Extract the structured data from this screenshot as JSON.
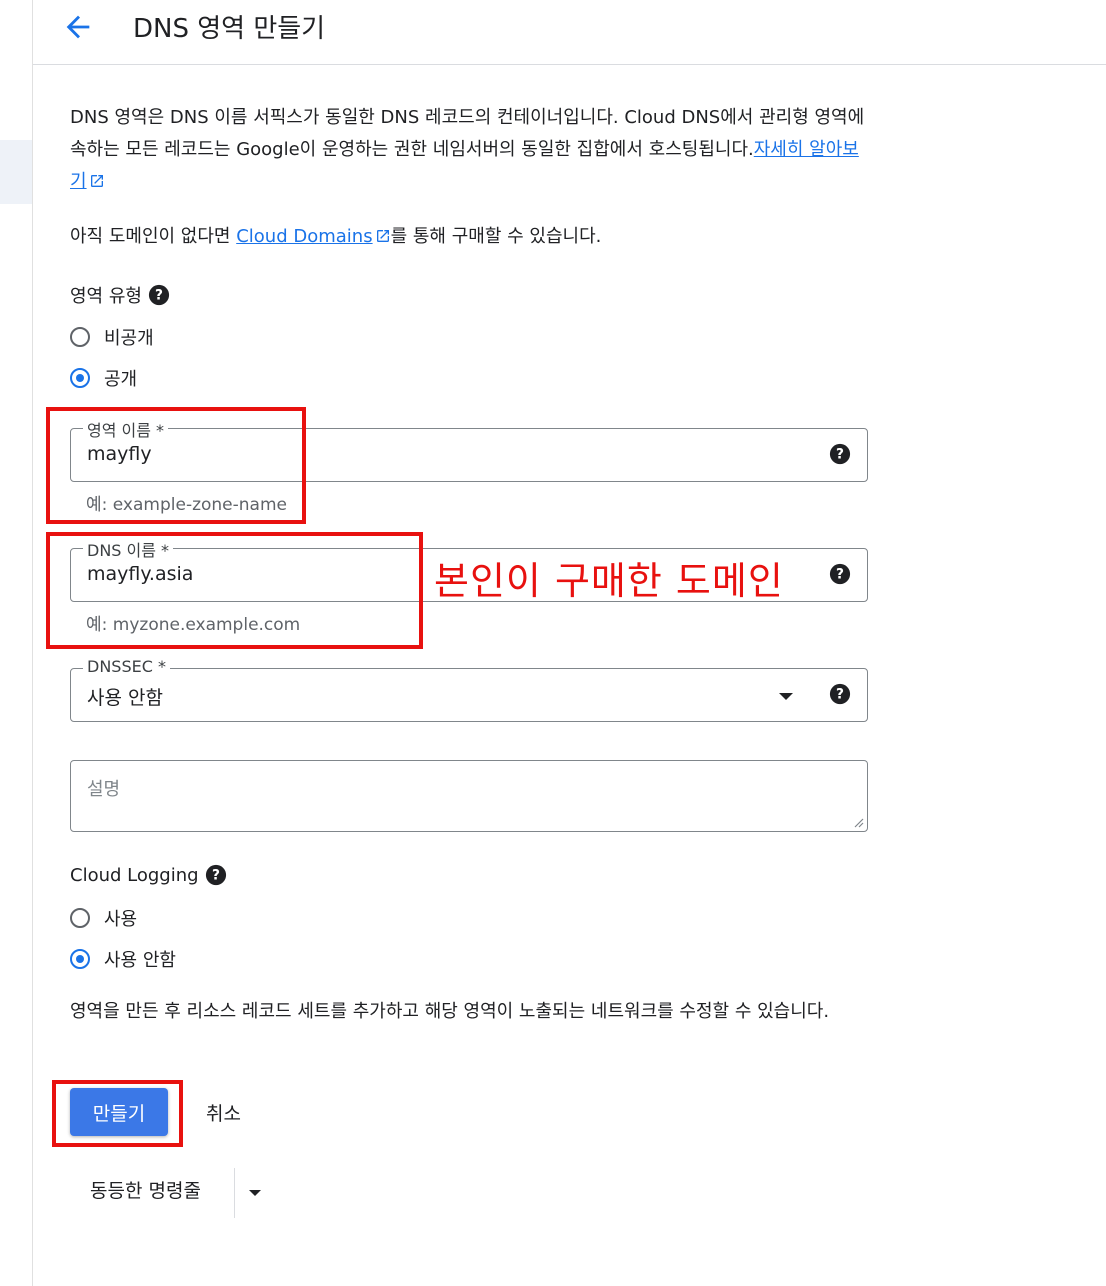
{
  "header": {
    "title": "DNS 영역 만들기"
  },
  "description": {
    "text": "DNS 영역은 DNS 이름 서픽스가 동일한 DNS 레코드의 컨테이너입니다. Cloud DNS에서 관리형 영역에 속하는 모든 레코드는 Google이 운영하는 권한 네임서버의 동일한 집합에서 호스팅됩니다.",
    "learn_more": "자세히 알아보기"
  },
  "domains": {
    "before": "아직 도메인이 없다면 ",
    "link": "Cloud Domains",
    "after": "를 통해 구매할 수 있습니다."
  },
  "zone_type": {
    "label": "영역 유형",
    "options": [
      {
        "label": "비공개",
        "checked": false
      },
      {
        "label": "공개",
        "checked": true
      }
    ]
  },
  "zone_name": {
    "label": "영역 이름 *",
    "value": "mayfly",
    "hint": "예: example-zone-name"
  },
  "dns_name": {
    "label": "DNS 이름 *",
    "value": "mayfly.asia",
    "hint": "예: myzone.example.com"
  },
  "dnssec": {
    "label": "DNSSEC *",
    "value": "사용 안함"
  },
  "description_field": {
    "placeholder": "설명"
  },
  "cloud_logging": {
    "label": "Cloud Logging",
    "options": [
      {
        "label": "사용",
        "checked": false
      },
      {
        "label": "사용 안함",
        "checked": true
      }
    ]
  },
  "note": "영역을 만든 후 리소스 레코드 세트를 추가하고 해당 영역이 노출되는 네트워크를 수정할 수 있습니다.",
  "actions": {
    "create": "만들기",
    "cancel": "취소",
    "equivalent_cmd": "동등한 명령줄"
  },
  "annotation": {
    "text": "본인이 구매한 도메인",
    "color": "#e8110f"
  },
  "colors": {
    "accent": "#1a73e8",
    "button": "#3b78e7"
  }
}
